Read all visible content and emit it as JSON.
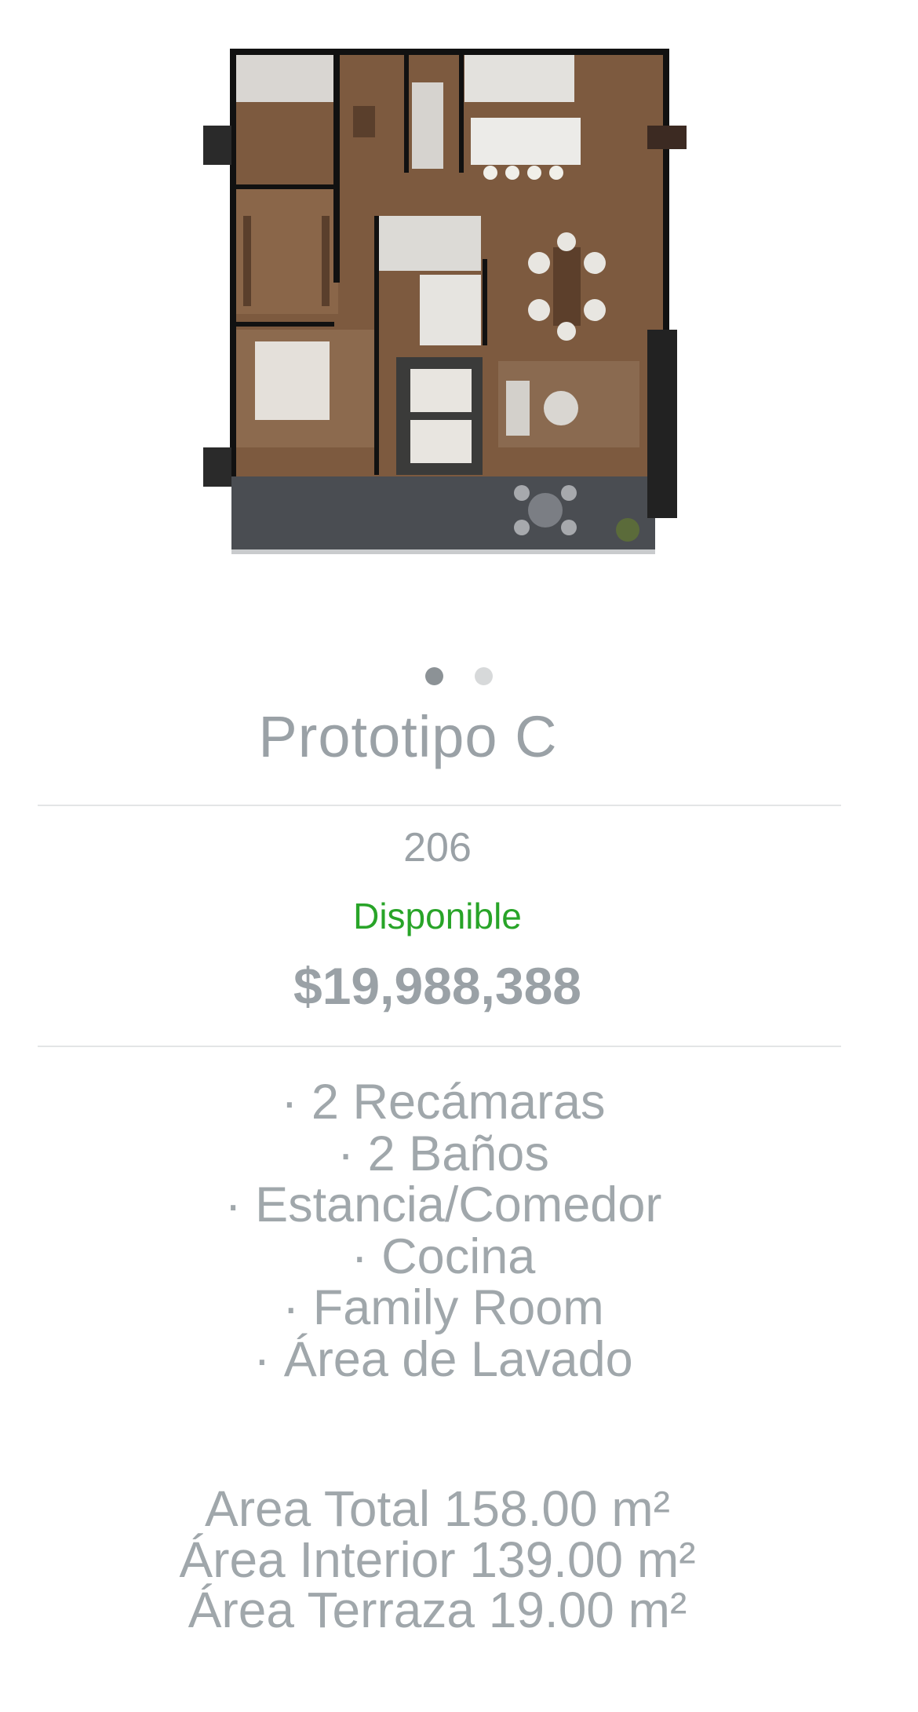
{
  "listing": {
    "title": "Prototipo C",
    "unit": "206",
    "status": "Disponible",
    "status_color": "#28a428",
    "price": "$19,988,388"
  },
  "carousel": {
    "slides": 2,
    "active_index": 0
  },
  "features": [
    "· 2 Recámaras",
    "· 2 Baños",
    "· Estancia/Comedor",
    "· Cocina",
    "· Family Room",
    "· Área de Lavado"
  ],
  "areas": [
    "Area Total 158.00 m²",
    "Área Interior 139.00 m²",
    "Área Terraza 19.00 m²"
  ],
  "colors": {
    "text_gray": "#9aa1a6",
    "rule": "#e3e5e6",
    "dot_active": "#8c9296",
    "dot_inactive": "#d7d9da"
  }
}
